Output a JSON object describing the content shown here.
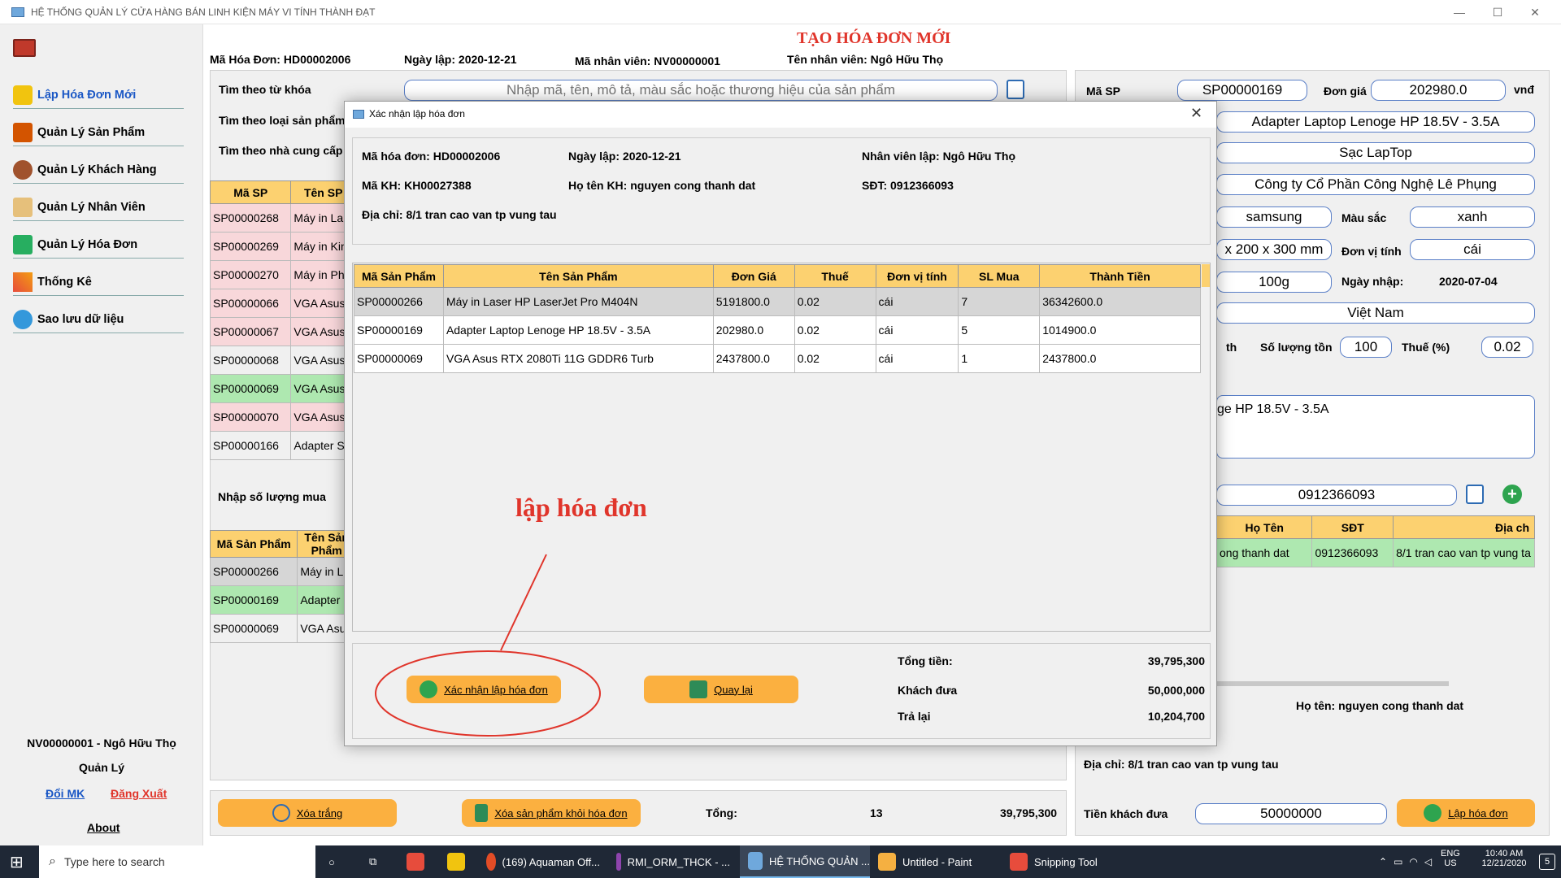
{
  "window": {
    "title": "HỆ THỐNG QUẢN LÝ CỬA HÀNG BÁN LINH KIỆN MÁY VI TÍNH THÀNH ĐẠT",
    "minimize": "—",
    "maximize": "☐",
    "close": "✕"
  },
  "sidebar": {
    "items": [
      {
        "label": "Lập Hóa Đơn Mới",
        "icon": "cart-icon"
      },
      {
        "label": "Quản Lý Sản Phẩm",
        "icon": "edit-icon"
      },
      {
        "label": "Quản Lý Khách Hàng",
        "icon": "customers-icon"
      },
      {
        "label": "Quản Lý Nhân Viên",
        "icon": "employee-icon"
      },
      {
        "label": "Quản Lý Hóa Đơn",
        "icon": "invoice-icon"
      },
      {
        "label": "Thống Kê",
        "icon": "chart-icon"
      },
      {
        "label": "Sao lưu dữ liệu",
        "icon": "backup-icon"
      }
    ],
    "user": "NV00000001 - Ngô Hữu  Thọ",
    "role": "Quản Lý",
    "change_password": "Đổi MK",
    "logout": "Đăng Xuất",
    "about": "About"
  },
  "header": {
    "title": "TẠO HÓA ĐƠN MỚI",
    "invoice_id": "Mã Hóa Đơn: HD00002006",
    "date": "Ngày lập: 2020-12-21",
    "employee_id": "Mã nhân viên: NV00000001",
    "employee_name": "Tên nhân viên: Ngô Hữu  Thọ"
  },
  "search": {
    "keyword_label": "Tìm theo từ khóa",
    "keyword_placeholder": "Nhập mã, tên, mô tả, màu sắc hoặc thương hiệu của sản phẩm",
    "type_label": "Tìm theo loại sản phẩm",
    "supplier_label": "Tìm theo nhà cung cấp"
  },
  "product_table": {
    "headers": [
      "Mã SP",
      "Tên SP"
    ],
    "rows": [
      {
        "id": "SP00000268",
        "name": "Máy in La",
        "style": "pink"
      },
      {
        "id": "SP00000269",
        "name": "Máy in Kin",
        "style": "pink"
      },
      {
        "id": "SP00000270",
        "name": "Máy in Ph",
        "style": "pink"
      },
      {
        "id": "SP00000066",
        "name": "VGA Asus",
        "style": "pink"
      },
      {
        "id": "SP00000067",
        "name": "VGA Asus",
        "style": "pink"
      },
      {
        "id": "SP00000068",
        "name": "VGA Asus",
        "style": "white"
      },
      {
        "id": "SP00000069",
        "name": "VGA Asus",
        "style": "green"
      },
      {
        "id": "SP00000070",
        "name": "VGA Asus",
        "style": "pink"
      },
      {
        "id": "SP00000166",
        "name": "Adapter S",
        "style": "white"
      }
    ]
  },
  "qty_label": "Nhập số lượng mua",
  "cart_table": {
    "headers": [
      "Mã Sản Phẩm",
      "Tên Sản Phẩm"
    ],
    "rows": [
      {
        "id": "SP00000266",
        "name": "Máy in L",
        "style": "gray"
      },
      {
        "id": "SP00000169",
        "name": "Adapter",
        "style": "green"
      },
      {
        "id": "SP00000069",
        "name": "VGA Asu",
        "style": "white"
      }
    ]
  },
  "bottom": {
    "clear": "Xóa trắng",
    "remove": "Xóa sản phẩm khỏi hóa đơn",
    "total_label": "Tổng:",
    "total_qty": "13",
    "total_amount": "39,795,300",
    "cash_label": "Tiền khách đưa",
    "cash_value": "50000000",
    "create": "Lập hóa đơn"
  },
  "detail": {
    "id_label": "Mã SP",
    "id_value": "SP00000169",
    "price_label": "Đơn giá",
    "price_value": "202980.0",
    "currency": "vnđ",
    "name_value": "Adapter Laptop Lenoge HP 18.5V - 3.5A",
    "type_value": "Sạc LapTop",
    "supplier_value": "Công ty Cổ Phần Công Nghệ Lê Phụng",
    "brand_value": "samsung",
    "color_label": "Màu sắc",
    "color_value": "xanh",
    "size_value": "x 200 x 300 mm",
    "unit_label": "Đơn vị tính",
    "unit_value": "cái",
    "weight_value": "100g",
    "import_label": "Ngày nhập:",
    "import_value": "2020-07-04",
    "origin_value": "Việt Nam",
    "warranty_partial": "th",
    "stock_label": "Số lượng tồn",
    "stock_value": "100",
    "tax_label": "Thuế (%)",
    "tax_value": "0.02",
    "desc_value": "ge HP 18.5V - 3.5A"
  },
  "customer": {
    "phone_value": "0912366093",
    "headers": [
      "Họ Tên",
      "SĐT",
      "Địa ch"
    ],
    "row": {
      "name": "ong thanh dat",
      "phone": "0912366093",
      "address": "8/1 tran cao van tp vung ta"
    },
    "name_line": "Họ tên: nguyen cong thanh dat",
    "address_line": "Địa chỉ: 8/1 tran cao van tp vung tau"
  },
  "dialog": {
    "title": "Xác nhận lập hóa đơn",
    "invoice": "Mã hóa đơn: HD00002006",
    "date": "Ngày lập: 2020-12-21",
    "employee": "Nhân viên lập: Ngô Hữu  Thọ",
    "customer_id": "Mã KH: KH00027388",
    "customer_name": "Họ tên KH: nguyen cong thanh dat",
    "phone": "SĐT: 0912366093",
    "address": "Địa chỉ: 8/1 tran cao van tp vung tau",
    "headers": [
      "Mã Sản Phẩm",
      "Tên Sản Phẩm",
      "Đơn Giá",
      "Thuế",
      "Đơn vị tính",
      "SL Mua",
      "Thành Tiền"
    ],
    "rows": [
      [
        "SP00000266",
        "Máy in Laser HP LaserJet Pro M404N",
        "5191800.0",
        "0.02",
        "cái",
        "7",
        "36342600.0"
      ],
      [
        "SP00000169",
        "Adapter Laptop Lenoge HP 18.5V - 3.5A",
        "202980.0",
        "0.02",
        "cái",
        "5",
        "1014900.0"
      ],
      [
        "SP00000069",
        "VGA Asus RTX 2080Ti 11G GDDR6 Turb",
        "2437800.0",
        "0.02",
        "cái",
        "1",
        "2437800.0"
      ]
    ],
    "confirm": "Xác nhận lập hóa đơn",
    "back": "Quay lại",
    "total_label": "Tổng tiền:",
    "total_value": "39,795,300",
    "paid_label": "Khách đưa",
    "paid_value": "50,000,000",
    "change_label": "Trả lại",
    "change_value": "10,204,700"
  },
  "annotation": "lập hóa đơn",
  "taskbar": {
    "search_placeholder": "Type here to search",
    "apps": [
      {
        "label": "(169) Aquaman Off...",
        "color": "#e34c26"
      },
      {
        "label": "RMI_ORM_THCK - ...",
        "color": "#8e44ad"
      },
      {
        "label": "HỆ THỐNG QUẢN ...",
        "color": "#6fa8dc"
      },
      {
        "label": "Untitled - Paint",
        "color": "#f5b041"
      },
      {
        "label": "Snipping Tool",
        "color": "#e74c3c"
      }
    ],
    "lang": "ENG",
    "region": "US",
    "time": "10:40 AM",
    "date": "12/21/2020",
    "notif": "5"
  }
}
